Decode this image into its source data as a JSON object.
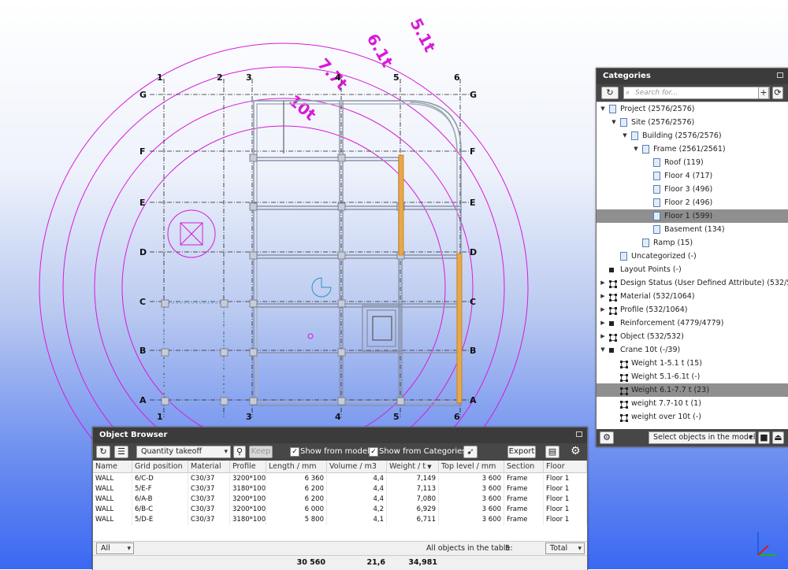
{
  "viewport": {
    "grid_columns": [
      "1",
      "2",
      "3",
      "4",
      "5",
      "6"
    ],
    "grid_rows": [
      "G",
      "F",
      "E",
      "D",
      "C",
      "B",
      "A"
    ],
    "crane_labels": [
      "5.1t",
      "6.1t",
      "7.7t",
      "10t"
    ],
    "crane_color": "#d81ad8"
  },
  "categories": {
    "title": "Categories",
    "search_placeholder": "Search for...",
    "bottom_select": "Select objects in the model",
    "tree": [
      {
        "label": "Project (2576/2576)",
        "level": 0,
        "expand": "down",
        "icon": "doc"
      },
      {
        "label": "Site (2576/2576)",
        "level": 1,
        "expand": "down",
        "icon": "doc"
      },
      {
        "label": "Building (2576/2576)",
        "level": 2,
        "expand": "down",
        "icon": "doc"
      },
      {
        "label": "Frame (2561/2561)",
        "level": 3,
        "expand": "down",
        "icon": "doc"
      },
      {
        "label": "Roof (119)",
        "level": 4,
        "expand": "",
        "icon": "doc"
      },
      {
        "label": "Floor 4 (717)",
        "level": 4,
        "expand": "",
        "icon": "doc"
      },
      {
        "label": "Floor 3 (496)",
        "level": 4,
        "expand": "",
        "icon": "doc"
      },
      {
        "label": "Floor 2 (496)",
        "level": 4,
        "expand": "",
        "icon": "doc"
      },
      {
        "label": "Floor 1 (599)",
        "level": 4,
        "expand": "",
        "icon": "doc",
        "selected": true
      },
      {
        "label": "Basement (134)",
        "level": 4,
        "expand": "",
        "icon": "doc"
      },
      {
        "label": "Ramp (15)",
        "level": 3,
        "expand": "",
        "icon": "doc"
      },
      {
        "label": "Uncategorized (-)",
        "level": 1,
        "expand": "",
        "icon": "doc"
      },
      {
        "label": "Layout Points (-)",
        "level": 0,
        "expand": "",
        "icon": "sq"
      },
      {
        "label": "Design Status (User Defined Attribute) (532/532)",
        "level": 0,
        "expand": "right",
        "icon": "net"
      },
      {
        "label": "Material (532/1064)",
        "level": 0,
        "expand": "right",
        "icon": "net"
      },
      {
        "label": "Profile (532/1064)",
        "level": 0,
        "expand": "right",
        "icon": "net"
      },
      {
        "label": "Reinforcement (4779/4779)",
        "level": 0,
        "expand": "right",
        "icon": "sq"
      },
      {
        "label": "Object (532/532)",
        "level": 0,
        "expand": "right",
        "icon": "net"
      },
      {
        "label": "Crane 10t (-/39)",
        "level": 0,
        "expand": "down",
        "icon": "sq"
      },
      {
        "label": "Weight 1-5.1 t (15)",
        "level": 1,
        "expand": "",
        "icon": "net"
      },
      {
        "label": "Weight 5.1-6.1t (-)",
        "level": 1,
        "expand": "",
        "icon": "net"
      },
      {
        "label": "Weight 6.1-7.7 t (23)",
        "level": 1,
        "expand": "",
        "icon": "net",
        "selected": true
      },
      {
        "label": "weight 7.7-10 t (1)",
        "level": 1,
        "expand": "",
        "icon": "net"
      },
      {
        "label": "weight over 10t (-)",
        "level": 1,
        "expand": "",
        "icon": "net"
      }
    ]
  },
  "object_browser": {
    "title": "Object Browser",
    "takeoff_select": "Quantity takeoff",
    "keep_label": "Keep",
    "show_from_model": "Show from model",
    "show_from_categories": "Show from Categories",
    "export_label": "Export",
    "columns": [
      "Name",
      "Grid position",
      "Material",
      "Profile",
      "Length / mm",
      "Volume / m3",
      "Weight / t",
      "Top level / mm",
      "Section",
      "Floor"
    ],
    "sort_column_index": 6,
    "rows": [
      [
        "WALL",
        "6/C-D",
        "C30/37",
        "3200*100",
        "6 360",
        "4,4",
        "7,149",
        "3 600",
        "Frame",
        "Floor 1"
      ],
      [
        "WALL",
        "5/E-F",
        "C30/37",
        "3180*100",
        "6 200",
        "4,4",
        "7,113",
        "3 600",
        "Frame",
        "Floor 1"
      ],
      [
        "WALL",
        "6/A-B",
        "C30/37",
        "3200*100",
        "6 200",
        "4,4",
        "7,080",
        "3 600",
        "Frame",
        "Floor 1"
      ],
      [
        "WALL",
        "6/B-C",
        "C30/37",
        "3200*100",
        "6 000",
        "4,2",
        "6,929",
        "3 600",
        "Frame",
        "Floor 1"
      ],
      [
        "WALL",
        "5/D-E",
        "C30/37",
        "3180*100",
        "5 800",
        "4,1",
        "6,711",
        "3 600",
        "Frame",
        "Floor 1"
      ]
    ],
    "filter_select": "All",
    "all_objects_label": "All objects in the table:",
    "all_objects_count": "5",
    "total_select": "Total",
    "totals": {
      "length": "30 560",
      "volume": "21,6",
      "weight": "34,981"
    }
  }
}
